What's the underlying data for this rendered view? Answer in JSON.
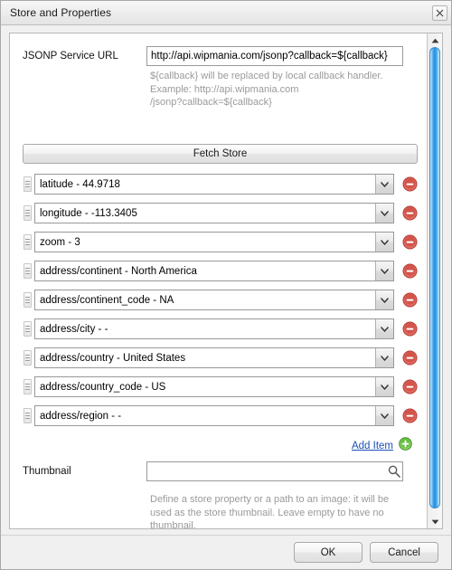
{
  "window": {
    "title": "Store and Properties",
    "close_icon": "close-icon"
  },
  "form": {
    "url_label": "JSONP Service URL",
    "url_value": "http://api.wipmania.com/jsonp?callback=${callback}",
    "url_placeholder": "",
    "url_hint": "${callback} will be replaced by local callback handler.\nExample: http://api.wipmania.com\n/jsonp?callback=${callback}",
    "fetch_label": "Fetch Store",
    "add_item_label": "Add Item",
    "add_item_icon": "plus-circle-icon",
    "thumbnail_label": "Thumbnail",
    "thumbnail_value": "",
    "thumbnail_placeholder": "",
    "thumbnail_browse_icon": "search-icon",
    "thumbnail_hint": "Define a store property or a path to an image: it will be\nused as the store thumbnail. Leave empty to have no\nthumbnail.\nExample: http://maps.googleapis.com/maps/api\n/staticmap?center=${/wipmania/latitude},${/wipmania\n/longitude}&zoom=${/wipmania/zoom}&size=80x80&"
  },
  "properties": [
    {
      "text": "latitude - 44.9718"
    },
    {
      "text": "longitude - -113.3405"
    },
    {
      "text": "zoom - 3"
    },
    {
      "text": "address/continent - North America"
    },
    {
      "text": "address/continent_code - NA"
    },
    {
      "text": "address/city - -"
    },
    {
      "text": "address/country - United States"
    },
    {
      "text": "address/country_code - US"
    },
    {
      "text": "address/region - -"
    }
  ],
  "scrollbar": {
    "up_icon": "scroll-up-arrow-icon",
    "down_icon": "scroll-down-arrow-icon"
  },
  "footer": {
    "ok_label": "OK",
    "cancel_label": "Cancel"
  },
  "colors": {
    "link": "#1b4fb8",
    "remove": "#d0473f",
    "add": "#4fa832",
    "scroll_thumb": "#1f8fe0"
  }
}
